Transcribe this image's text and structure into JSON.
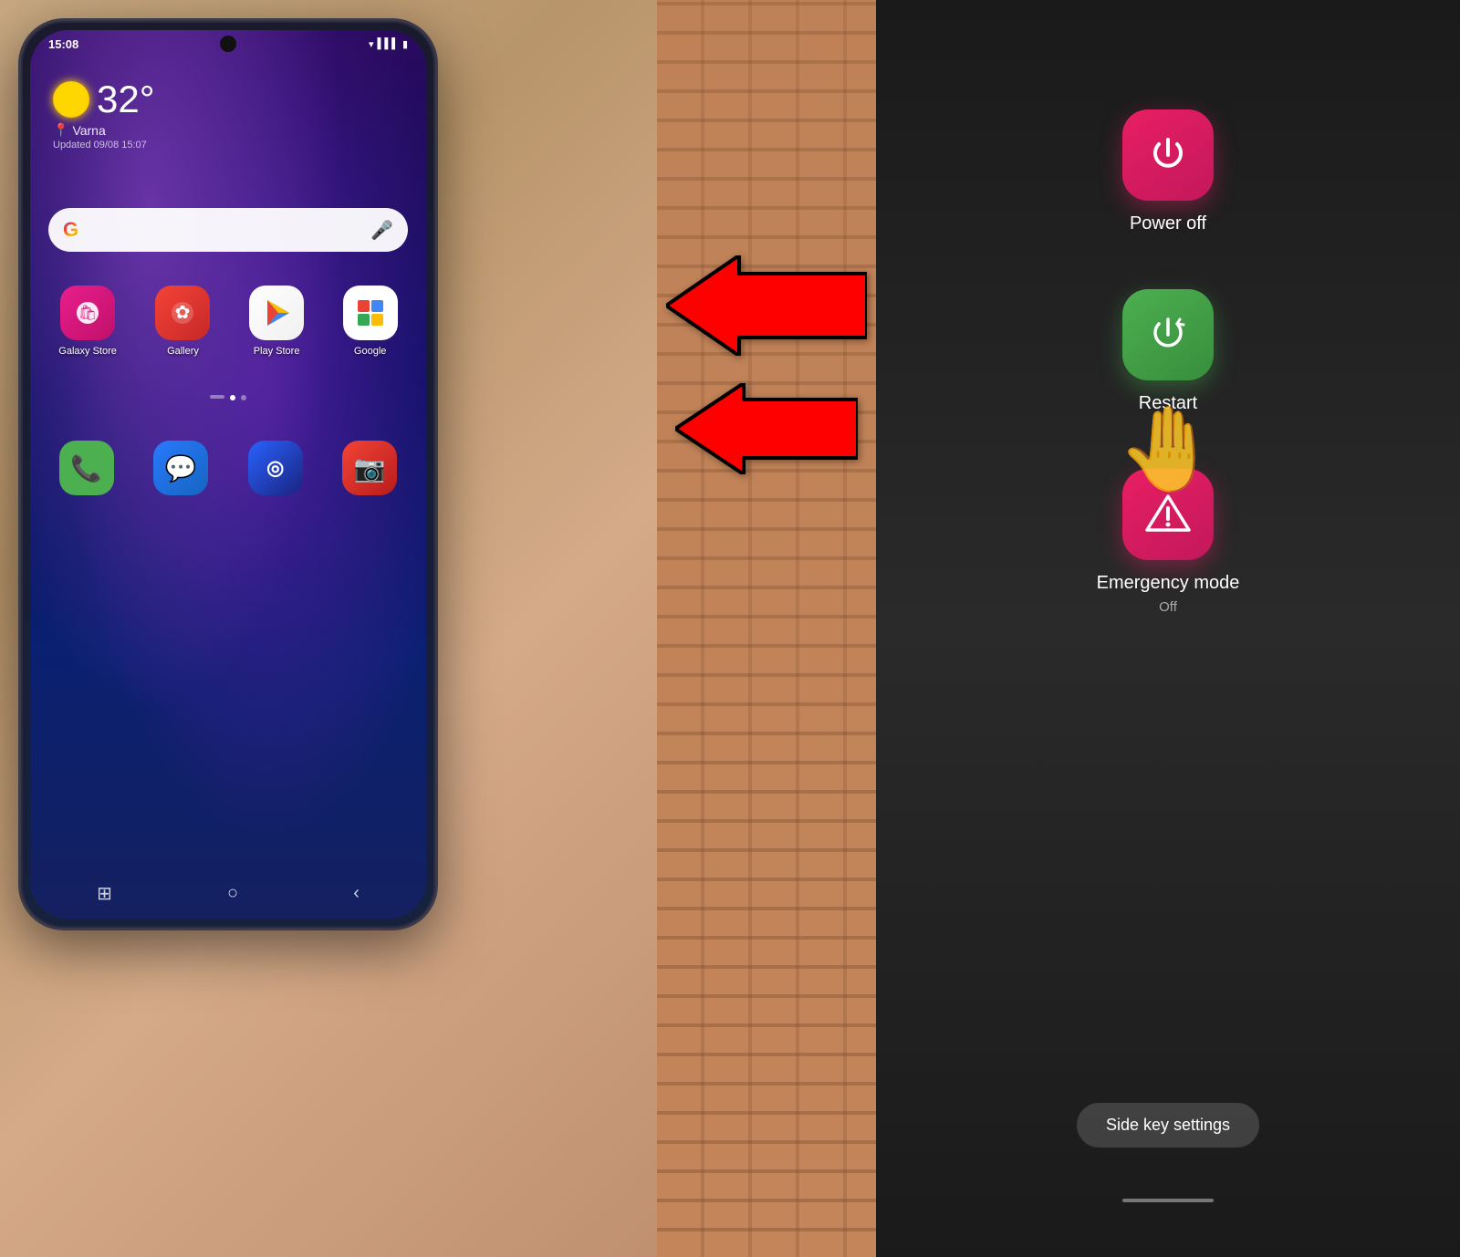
{
  "phone": {
    "status_time": "15:08",
    "weather": {
      "temperature": "32°",
      "location": "Varna",
      "updated": "Updated 09/08 15:07"
    },
    "apps": [
      {
        "label": "Galaxy Store",
        "icon_type": "galaxy"
      },
      {
        "label": "Gallery",
        "icon_type": "gallery"
      },
      {
        "label": "Play Store",
        "icon_type": "playstore"
      },
      {
        "label": "Google",
        "icon_type": "google"
      }
    ],
    "dock": [
      {
        "label": "Phone",
        "icon_type": "phone"
      },
      {
        "label": "Messages",
        "icon_type": "messages"
      },
      {
        "label": "Samsung",
        "icon_type": "samsung"
      },
      {
        "label": "Camera",
        "icon_type": "camera"
      }
    ]
  },
  "power_menu": {
    "items": [
      {
        "label": "Power off",
        "type": "power",
        "color": "red"
      },
      {
        "label": "Restart",
        "type": "restart",
        "color": "green"
      },
      {
        "label": "Emergency mode",
        "sublabel": "Off",
        "type": "emergency",
        "color": "red"
      }
    ],
    "side_key_settings": "Side key settings"
  },
  "arrows": {
    "count": 2,
    "direction": "left",
    "color": "#FF0000"
  }
}
